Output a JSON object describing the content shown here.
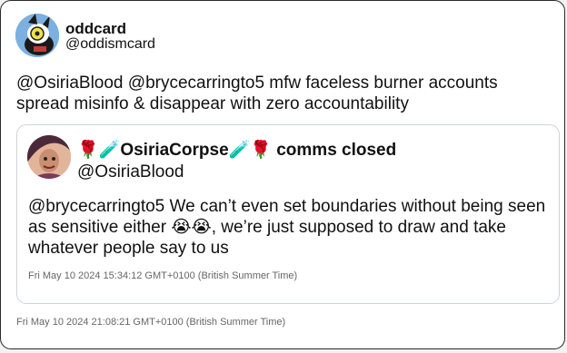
{
  "tweet": {
    "display_name": "oddcard",
    "handle": "@oddismcard",
    "text": "@OsiriaBlood @brycecarringto5 mfw faceless burner accounts spread misinfo & disappear with zero accountability",
    "timestamp": "Fri May 10 2024 21:08:21 GMT+0100 (British Summer Time)",
    "avatar_icon": "cartoon-character-avatar-icon"
  },
  "quoted": {
    "display_name": "🌹🧪OsiriaCorpse🧪🌹 comms closed",
    "handle": "@OsiriaBlood",
    "text": "@brycecarringto5 We can’t even set boundaries without being seen as sensitive either 😭😭, we’re just supposed to draw and take whatever people say to us",
    "timestamp": "Fri May 10 2024 15:34:12 GMT+0100 (British Summer Time)",
    "avatar_icon": "illustrated-character-avatar-icon"
  },
  "colors": {
    "card_border": "#2b2b2b",
    "quote_border": "#cfd4d9",
    "text": "#111111",
    "timestamp": "#666666"
  }
}
